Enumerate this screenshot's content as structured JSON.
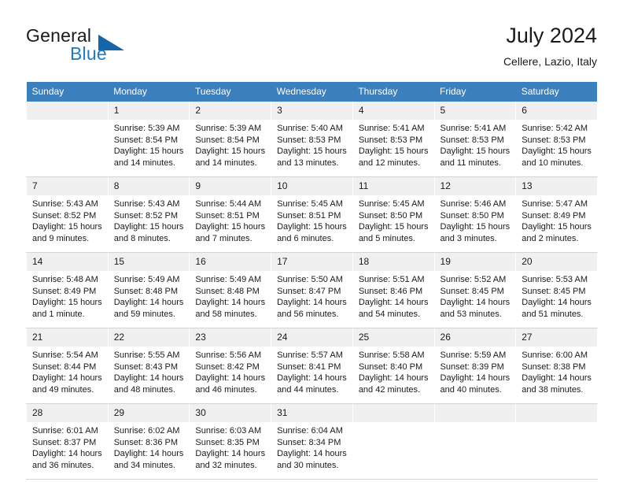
{
  "brand": {
    "name_part1": "General",
    "name_part2": "Blue",
    "triangle_icon": "triangle-logo-icon",
    "accent_color": "#1f7ac4"
  },
  "header": {
    "title": "July 2024",
    "subtitle": "Cellere, Lazio, Italy"
  },
  "calendar": {
    "header_bg": "#3c7fbd",
    "daynum_bg": "#f0f0f0",
    "weekday_names": [
      "Sunday",
      "Monday",
      "Tuesday",
      "Wednesday",
      "Thursday",
      "Friday",
      "Saturday"
    ],
    "weeks": [
      [
        {
          "day": "",
          "sunrise": "",
          "sunset": "",
          "daylight_line1": "",
          "daylight_line2": ""
        },
        {
          "day": "1",
          "sunrise": "Sunrise: 5:39 AM",
          "sunset": "Sunset: 8:54 PM",
          "daylight_line1": "Daylight: 15 hours",
          "daylight_line2": "and 14 minutes."
        },
        {
          "day": "2",
          "sunrise": "Sunrise: 5:39 AM",
          "sunset": "Sunset: 8:54 PM",
          "daylight_line1": "Daylight: 15 hours",
          "daylight_line2": "and 14 minutes."
        },
        {
          "day": "3",
          "sunrise": "Sunrise: 5:40 AM",
          "sunset": "Sunset: 8:53 PM",
          "daylight_line1": "Daylight: 15 hours",
          "daylight_line2": "and 13 minutes."
        },
        {
          "day": "4",
          "sunrise": "Sunrise: 5:41 AM",
          "sunset": "Sunset: 8:53 PM",
          "daylight_line1": "Daylight: 15 hours",
          "daylight_line2": "and 12 minutes."
        },
        {
          "day": "5",
          "sunrise": "Sunrise: 5:41 AM",
          "sunset": "Sunset: 8:53 PM",
          "daylight_line1": "Daylight: 15 hours",
          "daylight_line2": "and 11 minutes."
        },
        {
          "day": "6",
          "sunrise": "Sunrise: 5:42 AM",
          "sunset": "Sunset: 8:53 PM",
          "daylight_line1": "Daylight: 15 hours",
          "daylight_line2": "and 10 minutes."
        }
      ],
      [
        {
          "day": "7",
          "sunrise": "Sunrise: 5:43 AM",
          "sunset": "Sunset: 8:52 PM",
          "daylight_line1": "Daylight: 15 hours",
          "daylight_line2": "and 9 minutes."
        },
        {
          "day": "8",
          "sunrise": "Sunrise: 5:43 AM",
          "sunset": "Sunset: 8:52 PM",
          "daylight_line1": "Daylight: 15 hours",
          "daylight_line2": "and 8 minutes."
        },
        {
          "day": "9",
          "sunrise": "Sunrise: 5:44 AM",
          "sunset": "Sunset: 8:51 PM",
          "daylight_line1": "Daylight: 15 hours",
          "daylight_line2": "and 7 minutes."
        },
        {
          "day": "10",
          "sunrise": "Sunrise: 5:45 AM",
          "sunset": "Sunset: 8:51 PM",
          "daylight_line1": "Daylight: 15 hours",
          "daylight_line2": "and 6 minutes."
        },
        {
          "day": "11",
          "sunrise": "Sunrise: 5:45 AM",
          "sunset": "Sunset: 8:50 PM",
          "daylight_line1": "Daylight: 15 hours",
          "daylight_line2": "and 5 minutes."
        },
        {
          "day": "12",
          "sunrise": "Sunrise: 5:46 AM",
          "sunset": "Sunset: 8:50 PM",
          "daylight_line1": "Daylight: 15 hours",
          "daylight_line2": "and 3 minutes."
        },
        {
          "day": "13",
          "sunrise": "Sunrise: 5:47 AM",
          "sunset": "Sunset: 8:49 PM",
          "daylight_line1": "Daylight: 15 hours",
          "daylight_line2": "and 2 minutes."
        }
      ],
      [
        {
          "day": "14",
          "sunrise": "Sunrise: 5:48 AM",
          "sunset": "Sunset: 8:49 PM",
          "daylight_line1": "Daylight: 15 hours",
          "daylight_line2": "and 1 minute."
        },
        {
          "day": "15",
          "sunrise": "Sunrise: 5:49 AM",
          "sunset": "Sunset: 8:48 PM",
          "daylight_line1": "Daylight: 14 hours",
          "daylight_line2": "and 59 minutes."
        },
        {
          "day": "16",
          "sunrise": "Sunrise: 5:49 AM",
          "sunset": "Sunset: 8:48 PM",
          "daylight_line1": "Daylight: 14 hours",
          "daylight_line2": "and 58 minutes."
        },
        {
          "day": "17",
          "sunrise": "Sunrise: 5:50 AM",
          "sunset": "Sunset: 8:47 PM",
          "daylight_line1": "Daylight: 14 hours",
          "daylight_line2": "and 56 minutes."
        },
        {
          "day": "18",
          "sunrise": "Sunrise: 5:51 AM",
          "sunset": "Sunset: 8:46 PM",
          "daylight_line1": "Daylight: 14 hours",
          "daylight_line2": "and 54 minutes."
        },
        {
          "day": "19",
          "sunrise": "Sunrise: 5:52 AM",
          "sunset": "Sunset: 8:45 PM",
          "daylight_line1": "Daylight: 14 hours",
          "daylight_line2": "and 53 minutes."
        },
        {
          "day": "20",
          "sunrise": "Sunrise: 5:53 AM",
          "sunset": "Sunset: 8:45 PM",
          "daylight_line1": "Daylight: 14 hours",
          "daylight_line2": "and 51 minutes."
        }
      ],
      [
        {
          "day": "21",
          "sunrise": "Sunrise: 5:54 AM",
          "sunset": "Sunset: 8:44 PM",
          "daylight_line1": "Daylight: 14 hours",
          "daylight_line2": "and 49 minutes."
        },
        {
          "day": "22",
          "sunrise": "Sunrise: 5:55 AM",
          "sunset": "Sunset: 8:43 PM",
          "daylight_line1": "Daylight: 14 hours",
          "daylight_line2": "and 48 minutes."
        },
        {
          "day": "23",
          "sunrise": "Sunrise: 5:56 AM",
          "sunset": "Sunset: 8:42 PM",
          "daylight_line1": "Daylight: 14 hours",
          "daylight_line2": "and 46 minutes."
        },
        {
          "day": "24",
          "sunrise": "Sunrise: 5:57 AM",
          "sunset": "Sunset: 8:41 PM",
          "daylight_line1": "Daylight: 14 hours",
          "daylight_line2": "and 44 minutes."
        },
        {
          "day": "25",
          "sunrise": "Sunrise: 5:58 AM",
          "sunset": "Sunset: 8:40 PM",
          "daylight_line1": "Daylight: 14 hours",
          "daylight_line2": "and 42 minutes."
        },
        {
          "day": "26",
          "sunrise": "Sunrise: 5:59 AM",
          "sunset": "Sunset: 8:39 PM",
          "daylight_line1": "Daylight: 14 hours",
          "daylight_line2": "and 40 minutes."
        },
        {
          "day": "27",
          "sunrise": "Sunrise: 6:00 AM",
          "sunset": "Sunset: 8:38 PM",
          "daylight_line1": "Daylight: 14 hours",
          "daylight_line2": "and 38 minutes."
        }
      ],
      [
        {
          "day": "28",
          "sunrise": "Sunrise: 6:01 AM",
          "sunset": "Sunset: 8:37 PM",
          "daylight_line1": "Daylight: 14 hours",
          "daylight_line2": "and 36 minutes."
        },
        {
          "day": "29",
          "sunrise": "Sunrise: 6:02 AM",
          "sunset": "Sunset: 8:36 PM",
          "daylight_line1": "Daylight: 14 hours",
          "daylight_line2": "and 34 minutes."
        },
        {
          "day": "30",
          "sunrise": "Sunrise: 6:03 AM",
          "sunset": "Sunset: 8:35 PM",
          "daylight_line1": "Daylight: 14 hours",
          "daylight_line2": "and 32 minutes."
        },
        {
          "day": "31",
          "sunrise": "Sunrise: 6:04 AM",
          "sunset": "Sunset: 8:34 PM",
          "daylight_line1": "Daylight: 14 hours",
          "daylight_line2": "and 30 minutes."
        },
        {
          "day": "",
          "sunrise": "",
          "sunset": "",
          "daylight_line1": "",
          "daylight_line2": ""
        },
        {
          "day": "",
          "sunrise": "",
          "sunset": "",
          "daylight_line1": "",
          "daylight_line2": ""
        },
        {
          "day": "",
          "sunrise": "",
          "sunset": "",
          "daylight_line1": "",
          "daylight_line2": ""
        }
      ]
    ]
  }
}
